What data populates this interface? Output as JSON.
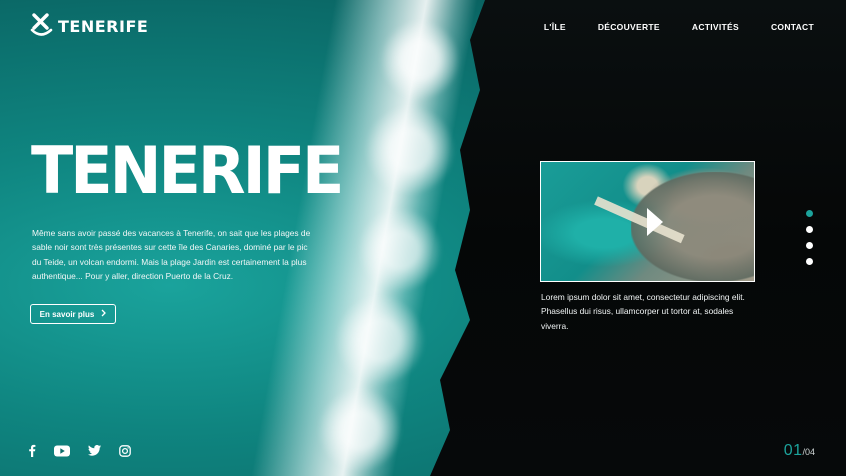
{
  "brand": {
    "name": "TENERIFE",
    "logo_icon": "x-smile-logo-icon"
  },
  "nav": {
    "items": [
      "L'ÎLE",
      "DÉCOUVERTE",
      "ACTIVITÉS",
      "CONTACT"
    ]
  },
  "hero": {
    "title": "TENERIFE",
    "text": "Même sans avoir passé des vacances à Tenerife, on sait que les plages de sable noir sont très présentes sur cette île des Canaries, dominé par le pic du Teide, un volcan endormi. Mais la plage Jardin est certainement la plus authentique... Pour y aller, direction Puerto de la Cruz.",
    "cta_label": "En savoir plus",
    "cta_icon": "chevron-right-icon"
  },
  "video": {
    "play_icon": "play-icon",
    "caption": "Lorem ipsum dolor sit amet, consectetur adipiscing elit. Phasellus dui risus, ullamcorper ut tortor at, sodales viverra."
  },
  "pager": {
    "count": 4,
    "active_index": 0
  },
  "social": {
    "icons": [
      "facebook-icon",
      "youtube-icon",
      "twitter-icon",
      "instagram-icon"
    ]
  },
  "counter": {
    "current": "01",
    "total": "/04"
  },
  "colors": {
    "accent": "#1ca39c",
    "text": "#ffffff",
    "dark_bg": "#050808"
  }
}
